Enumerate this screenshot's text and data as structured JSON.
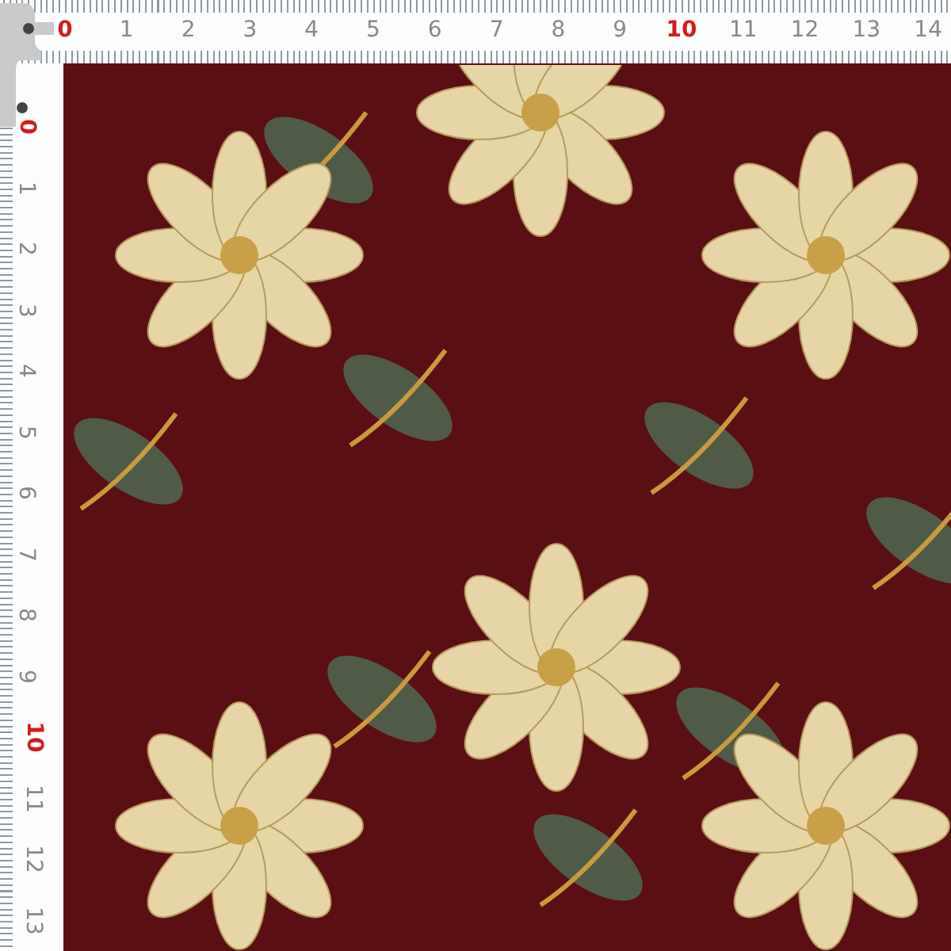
{
  "top_ruler": {
    "numbers": [
      {
        "label": "0",
        "highlighted": true
      },
      {
        "label": "1",
        "highlighted": false
      },
      {
        "label": "2",
        "highlighted": false
      },
      {
        "label": "3",
        "highlighted": false
      },
      {
        "label": "4",
        "highlighted": false
      },
      {
        "label": "5",
        "highlighted": false
      },
      {
        "label": "6",
        "highlighted": false
      },
      {
        "label": "7",
        "highlighted": false
      },
      {
        "label": "8",
        "highlighted": false
      },
      {
        "label": "9",
        "highlighted": false
      },
      {
        "label": "10",
        "highlighted": true
      },
      {
        "label": "11",
        "highlighted": false
      },
      {
        "label": "12",
        "highlighted": false
      },
      {
        "label": "13",
        "highlighted": false
      },
      {
        "label": "14",
        "highlighted": false
      }
    ]
  },
  "left_ruler": {
    "numbers": [
      {
        "label": "0",
        "highlighted": true
      },
      {
        "label": "1",
        "highlighted": false
      },
      {
        "label": "2",
        "highlighted": false
      },
      {
        "label": "3",
        "highlighted": false
      },
      {
        "label": "4",
        "highlighted": false
      },
      {
        "label": "5",
        "highlighted": false
      },
      {
        "label": "6",
        "highlighted": false
      },
      {
        "label": "7",
        "highlighted": false
      },
      {
        "label": "8",
        "highlighted": false
      },
      {
        "label": "9",
        "highlighted": false
      },
      {
        "label": "10",
        "highlighted": true
      },
      {
        "label": "11",
        "highlighted": false
      },
      {
        "label": "12",
        "highlighted": false
      },
      {
        "label": "13",
        "highlighted": false
      }
    ]
  }
}
